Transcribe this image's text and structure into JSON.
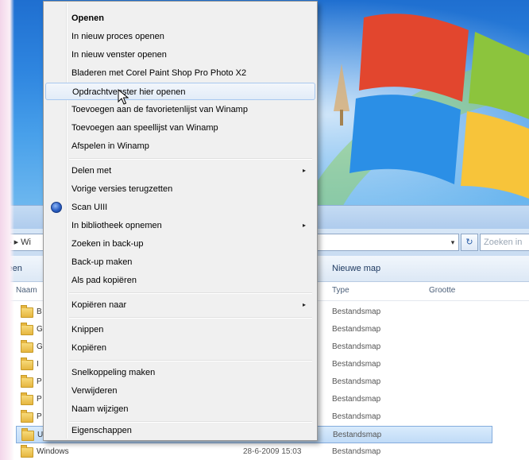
{
  "context_menu": {
    "items": [
      {
        "label": "Openen"
      },
      {
        "label": "In nieuw proces openen"
      },
      {
        "label": "In nieuw venster openen"
      },
      {
        "label": "Bladeren met Corel Paint Shop Pro Photo X2"
      },
      {
        "label": "Opdrachtvenster hier openen"
      },
      {
        "label": "Toevoegen aan de favorietenlijst van Winamp"
      },
      {
        "label": "Toevoegen aan speellijst van Winamp"
      },
      {
        "label": "Afspelen in Winamp"
      },
      {
        "label": "Delen met"
      },
      {
        "label": "Vorige versies terugzetten"
      },
      {
        "label": "Scan UIII"
      },
      {
        "label": "In bibliotheek opnemen"
      },
      {
        "label": "Zoeken in back-up"
      },
      {
        "label": "Back-up maken"
      },
      {
        "label": "Als pad kopiëren"
      },
      {
        "label": "Kopiëren naar"
      },
      {
        "label": "Knippen"
      },
      {
        "label": "Kopiëren"
      },
      {
        "label": "Snelkoppeling maken"
      },
      {
        "label": "Verwijderen"
      },
      {
        "label": "Naam wijzigen"
      },
      {
        "label": "Eigenschappen"
      }
    ],
    "submenu_arrow": "▸"
  },
  "explorer": {
    "address_prefix": "▸ ▸ Wi",
    "address_dropdown": "▾",
    "refresh_icon": "↻",
    "search_placeholder": "Zoeken in",
    "command_left": "seen",
    "new_folder_label": "Nieuwe map",
    "columns": {
      "name": "Naam",
      "type": "Type",
      "size": "Grootte"
    },
    "files": [
      {
        "name": "B",
        "date": "",
        "type": "Bestandsmap"
      },
      {
        "name": "G",
        "date": "",
        "type": "Bestandsmap"
      },
      {
        "name": "G",
        "date": "",
        "type": "Bestandsmap"
      },
      {
        "name": "I",
        "date": "",
        "type": "Bestandsmap"
      },
      {
        "name": "P",
        "date": "",
        "type": "Bestandsmap"
      },
      {
        "name": "P",
        "date": "",
        "type": "Bestandsmap"
      },
      {
        "name": "P",
        "date": "",
        "type": "Bestandsmap"
      },
      {
        "name": "U",
        "date": "",
        "type": "Bestandsmap",
        "selected": true
      },
      {
        "name": "Windows",
        "date": "28-6-2009 15:03",
        "type": "Bestandsmap"
      }
    ]
  },
  "colors": {
    "wallpaper_blue": "#2f86e0",
    "menu_background": "#f0f0f0",
    "selection_blue": "#c0dbf7"
  }
}
